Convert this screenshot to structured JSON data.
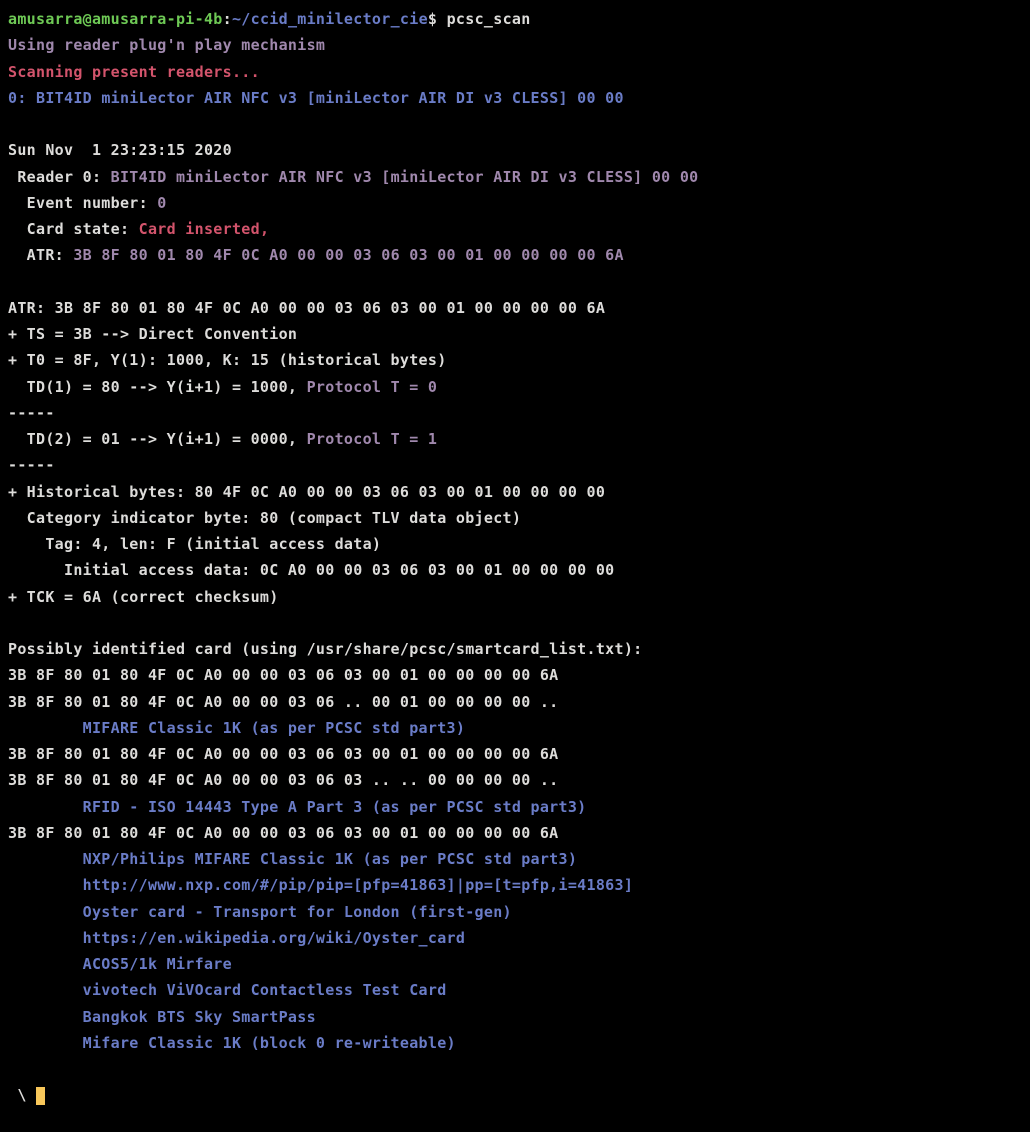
{
  "prompt": {
    "user": "amusarra@amusarra-pi-4b",
    "colon": ":",
    "path": "~/ccid_minilector_cie",
    "dollar": "$",
    "command": " pcsc_scan"
  },
  "l1": "Using reader plug'n play mechanism",
  "l2": "Scanning present readers...",
  "l3a": "0: ",
  "l3b": "BIT4ID miniLector AIR NFC v3 [miniLector AIR DI v3 CLESS] 00 00",
  "l4": "Sun Nov  1 23:23:15 2020",
  "l5a": " Reader 0: ",
  "l5b": "BIT4ID miniLector AIR NFC v3 [miniLector AIR DI v3 CLESS] 00 00",
  "l6a": "  Event number: ",
  "l6b": "0",
  "l7a": "  Card state: ",
  "l7b": "Card inserted, ",
  "l8a": "  ATR: ",
  "l8b": "3B 8F 80 01 80 4F 0C A0 00 00 03 06 03 00 01 00 00 00 00 6A",
  "l9": "ATR: 3B 8F 80 01 80 4F 0C A0 00 00 03 06 03 00 01 00 00 00 00 6A",
  "l10": "+ TS = 3B --> Direct Convention",
  "l11": "+ T0 = 8F, Y(1): 1000, K: 15 (historical bytes)",
  "l12a": "  TD(1) = 80 --> Y(i+1) = 1000, ",
  "l12b": "Protocol T = 0",
  "l13": "-----",
  "l14a": "  TD(2) = 01 --> Y(i+1) = 0000, ",
  "l14b": "Protocol T = 1",
  "l15": "-----",
  "l16": "+ Historical bytes: 80 4F 0C A0 00 00 03 06 03 00 01 00 00 00 00",
  "l17": "  Category indicator byte: 80 (compact TLV data object)",
  "l18": "    Tag: 4, len: F (initial access data)",
  "l19": "      Initial access data: 0C A0 00 00 03 06 03 00 01 00 00 00 00",
  "l20": "+ TCK = 6A (correct checksum)",
  "l21": "Possibly identified card (using /usr/share/pcsc/smartcard_list.txt):",
  "l22": "3B 8F 80 01 80 4F 0C A0 00 00 03 06 03 00 01 00 00 00 00 6A",
  "l23": "3B 8F 80 01 80 4F 0C A0 00 00 03 06 .. 00 01 00 00 00 00 ..",
  "l24": "        MIFARE Classic 1K (as per PCSC std part3)",
  "l25": "3B 8F 80 01 80 4F 0C A0 00 00 03 06 03 00 01 00 00 00 00 6A",
  "l26": "3B 8F 80 01 80 4F 0C A0 00 00 03 06 03 .. .. 00 00 00 00 ..",
  "l27": "        RFID - ISO 14443 Type A Part 3 (as per PCSC std part3)",
  "l28": "3B 8F 80 01 80 4F 0C A0 00 00 03 06 03 00 01 00 00 00 00 6A",
  "l29": "        NXP/Philips MIFARE Classic 1K (as per PCSC std part3)",
  "l30": "        http://www.nxp.com/#/pip/pip=[pfp=41863]|pp=[t=pfp,i=41863]",
  "l31": "        Oyster card - Transport for London (first-gen)",
  "l32": "        https://en.wikipedia.org/wiki/Oyster_card",
  "l33": "        ACOS5/1k Mirfare",
  "l34": "        vivotech ViVOcard Contactless Test Card",
  "l35": "        Bangkok BTS Sky SmartPass",
  "l36": "        Mifare Classic 1K (block 0 re-writeable)",
  "cursor_prefix": " \\ "
}
